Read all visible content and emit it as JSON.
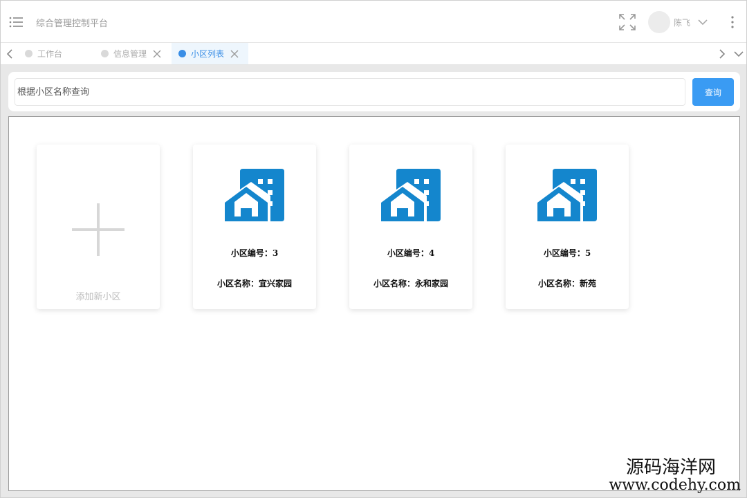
{
  "header": {
    "app_title": "综合管理控制平台",
    "user_name": "陈飞"
  },
  "tabs": [
    {
      "label": "工作台",
      "active": false,
      "closable": false
    },
    {
      "label": "信息管理",
      "active": false,
      "closable": true
    },
    {
      "label": "小区列表",
      "active": true,
      "closable": true
    }
  ],
  "search": {
    "placeholder": "根据小区名称查询",
    "value": "",
    "button_label": "查询"
  },
  "add_card": {
    "label": "添加新小区"
  },
  "communities": [
    {
      "code_text": "小区编号：3",
      "name_text": "小区名称：宜兴家园"
    },
    {
      "code_text": "小区编号：4",
      "name_text": "小区名称：永和家园"
    },
    {
      "code_text": "小区编号：5",
      "name_text": "小区名称：新苑"
    }
  ],
  "watermark": {
    "cn": "源码海洋网",
    "en": "www.codehy.com"
  },
  "colors": {
    "accent": "#3a9bf3",
    "building_icon": "#1486cd",
    "active_tab_bg": "#eef6fd"
  }
}
